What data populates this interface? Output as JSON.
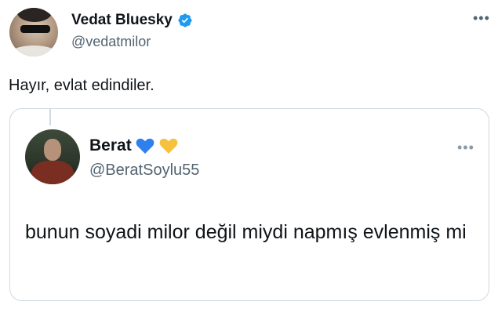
{
  "tweet": {
    "author_name": "Vedat Bluesky",
    "author_handle": "@vedatmilor",
    "text": "Hayır, evlat edindiler.",
    "icons": {
      "verified": "verified-badge-icon",
      "more": "more-options-icon"
    },
    "colors": {
      "verified": "#1d9bf0",
      "handle": "#536471"
    }
  },
  "quote": {
    "author_name": "Berat",
    "author_handle": "@BeratSoylu55",
    "text": "bunun soyadi milor değil miydi napmış evlenmiş mi",
    "icons": {
      "hearts": [
        "blue-heart-icon",
        "yellow-heart-icon"
      ],
      "more": "more-options-icon"
    },
    "colors": {
      "blue_heart": "#2f80ed",
      "yellow_heart": "#f6c23e",
      "border": "#cfd9de"
    }
  }
}
